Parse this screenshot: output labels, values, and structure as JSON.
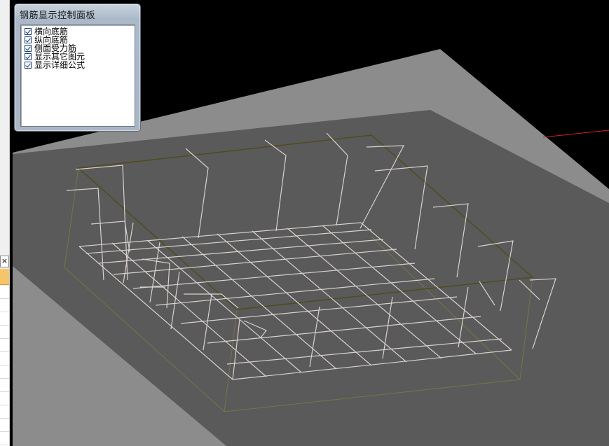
{
  "panel": {
    "title": "钢筋显示控制面板",
    "options": [
      {
        "label": "横向底筋",
        "checked": true
      },
      {
        "label": "纵向底筋",
        "checked": true
      },
      {
        "label": "侧面受力筋",
        "checked": true
      },
      {
        "label": "显示其它图元",
        "checked": true
      },
      {
        "label": "显示详细公式",
        "checked": true
      }
    ]
  },
  "left_window": {
    "close_glyph": "×"
  },
  "colors": {
    "background": "#000000",
    "slab_light": "#8c8c8c",
    "slab_dark": "#5a5a5a",
    "rebar": "#d9d2cf",
    "outline": "#6f6a3a",
    "axis": "#d42020"
  }
}
